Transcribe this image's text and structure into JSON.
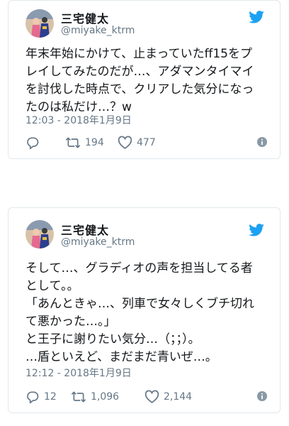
{
  "tweets": [
    {
      "display_name": "三宅健太",
      "handle": "@miyake_ktrm",
      "text": "年末年始にかけて、止まっていたff15をプ\nレイしてみたのだが…、アダマンタイマイ\nを討伐した時点で、クリアした気分になっ\nたのは私だけ…？w",
      "timestamp": "12:03 - 2018年1月9日",
      "reply_count": "",
      "retweet_count": "194",
      "like_count": "477"
    },
    {
      "display_name": "三宅健太",
      "handle": "@miyake_ktrm",
      "text": "そして…、グラディオの声を担当してる者\nとして。。\n「あんときゃ…、列車で女々しくブチ切れ\nて悪かった…。」\nと王子に謝りたい気分…（；；）。\n…盾といえど、まだまだ青いぜ…。",
      "timestamp": "12:12 - 2018年1月9日",
      "reply_count": "12",
      "retweet_count": "1,096",
      "like_count": "2,144"
    }
  ],
  "icons": {
    "brand": "twitter-bird-icon",
    "reply": "reply-icon",
    "retweet": "retweet-icon",
    "like": "heart-icon",
    "info": "info-icon"
  },
  "colors": {
    "twitter_blue": "#1da1f2",
    "secondary_text": "#657786",
    "border": "#e1e8ed"
  }
}
